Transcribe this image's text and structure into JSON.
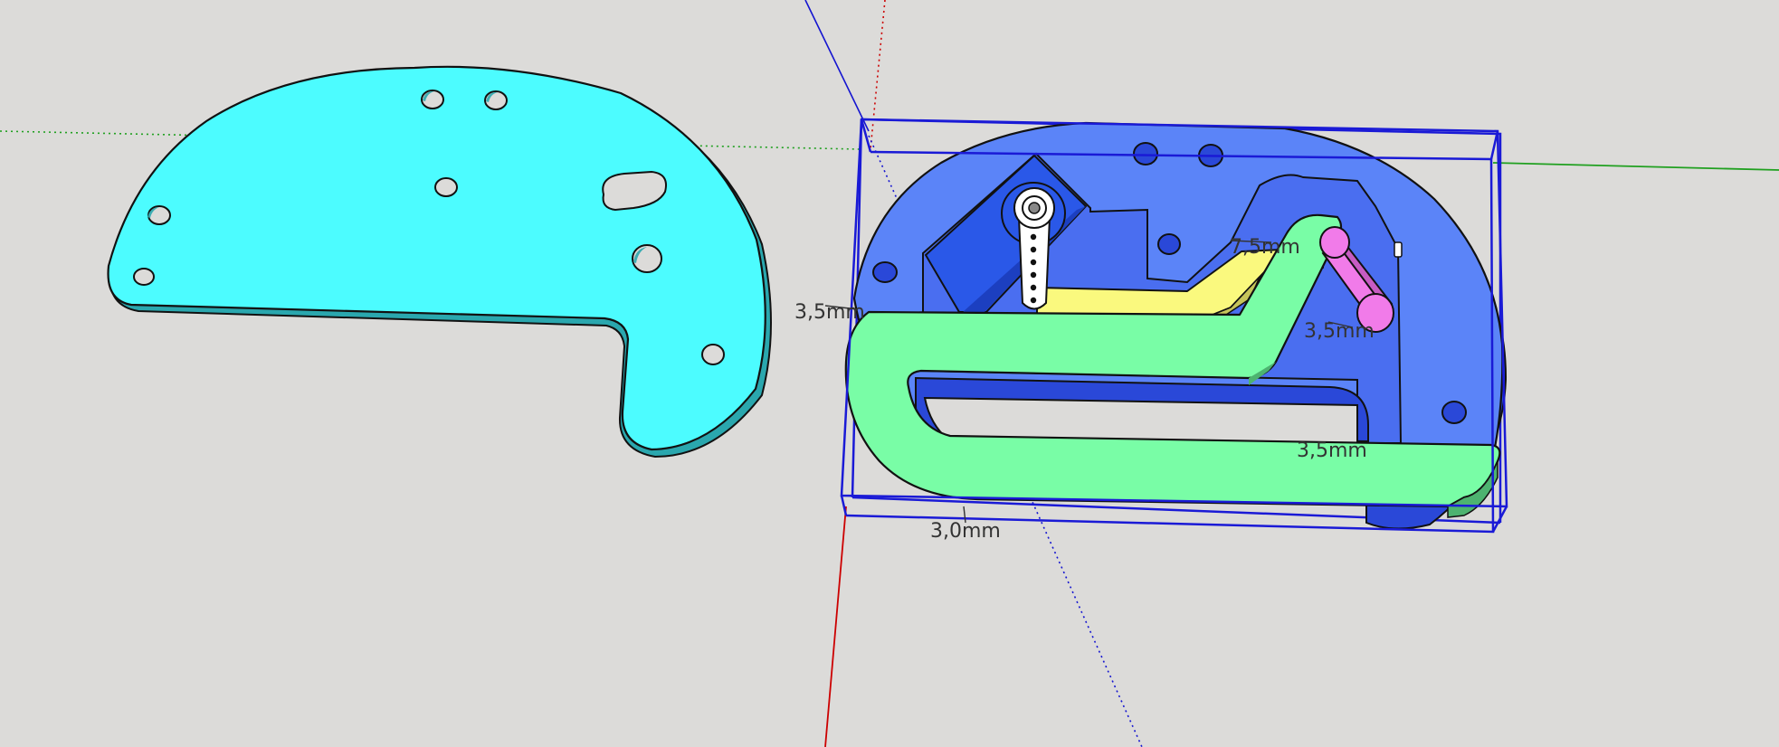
{
  "dimensions": {
    "left_plate": "3,5mm",
    "top_arm": "7,5mm",
    "pink_link": "3,5mm",
    "green_arm": "3,5mm",
    "bottom": "3,0mm"
  },
  "colors": {
    "background": "#dcdbd9",
    "cyan_plate": "#4cfcff",
    "blue_plate": "#5b84f8",
    "green_arm": "#79fda6",
    "yellow_arm": "#faf97e",
    "pink_link": "#f17be9",
    "bounding_box": "#1a1ad6",
    "axis_red": "#cc0000",
    "axis_green": "#20a020",
    "axis_blue": "#1414d0"
  },
  "icons": {
    "servo_horn": "servo-horn-icon"
  }
}
